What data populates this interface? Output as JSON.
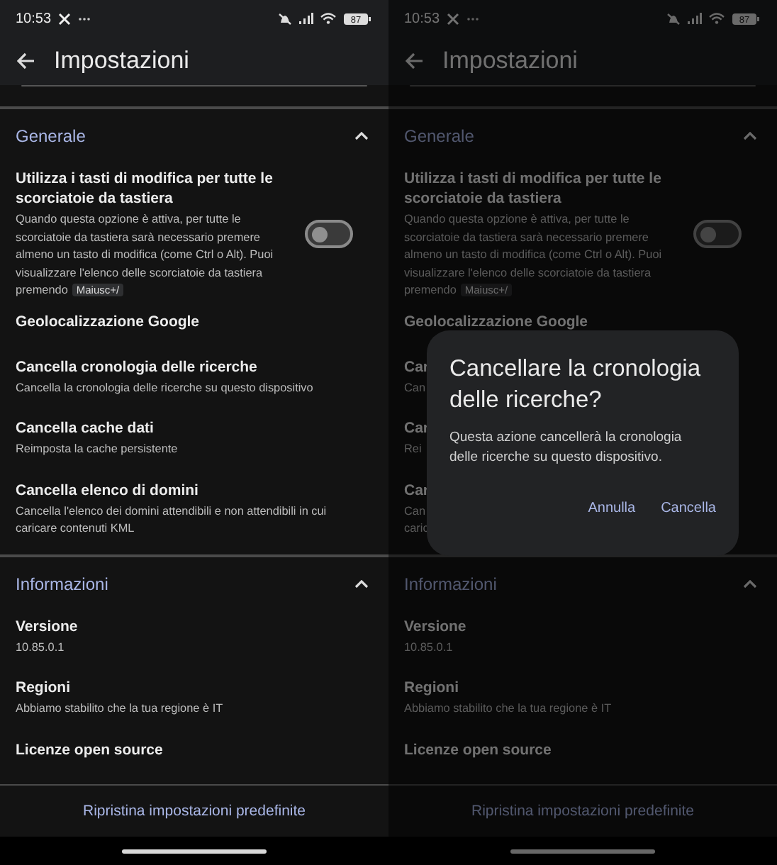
{
  "screens": [
    {
      "dimmed": false,
      "status": {
        "time": "10:53",
        "battery": "87"
      },
      "title": "Impostazioni",
      "sections": [
        {
          "title": "Generale",
          "expanded": true,
          "items": [
            {
              "kind": "toggle",
              "title": "Utilizza i tasti di modifica per tutte le scorciatoie da tastiera",
              "description": "Quando questa opzione è attiva, per tutte le scorciatoie da tastiera sarà necessario premere almeno un tasto di modifica (come Ctrl o Alt). Puoi visualizzare l'elenco delle scorciatoie da tastiera premendo",
              "shortcut": "Maiusc+/",
              "on": false
            },
            {
              "kind": "text",
              "title": "Geolocalizzazione Google"
            },
            {
              "kind": "text",
              "title": "Cancella cronologia delle ricerche",
              "description": "Cancella la cronologia delle ricerche su questo dispositivo"
            },
            {
              "kind": "text",
              "title": "Cancella cache dati",
              "description": "Reimposta la cache persistente"
            },
            {
              "kind": "text",
              "title": "Cancella elenco di domini",
              "description": "Cancella l'elenco dei domini attendibili e non attendibili in cui caricare contenuti KML"
            }
          ]
        },
        {
          "title": "Informazioni",
          "expanded": true,
          "items": [
            {
              "kind": "text",
              "title": "Versione",
              "description": "10.85.0.1"
            },
            {
              "kind": "text",
              "title": "Regioni",
              "description": "Abbiamo stabilito che la tua regione è IT"
            },
            {
              "kind": "text",
              "title": "Licenze open source"
            }
          ]
        }
      ],
      "footer": "Ripristina impostazioni predefinite"
    },
    {
      "dimmed": true,
      "status": {
        "time": "10:53",
        "battery": "87"
      },
      "title": "Impostazioni",
      "sections": [
        {
          "title": "Generale",
          "expanded": true,
          "items": [
            {
              "kind": "toggle",
              "title": "Utilizza i tasti di modifica per tutte le scorciatoie da tastiera",
              "description": "Quando questa opzione è attiva, per tutte le scorciatoie da tastiera sarà necessario premere almeno un tasto di modifica (come Ctrl o Alt). Puoi visualizzare l'elenco delle scorciatoie da tastiera premendo",
              "shortcut": "Maiusc+/",
              "on": false
            },
            {
              "kind": "text",
              "title": "Geolocalizzazione Google"
            },
            {
              "kind": "text",
              "title": "Car",
              "description": "Can"
            },
            {
              "kind": "text",
              "title": "Car",
              "description": "Rei"
            },
            {
              "kind": "text",
              "title": "Car",
              "description": "Can\ncaric"
            }
          ]
        },
        {
          "title": "Informazioni",
          "expanded": true,
          "items": [
            {
              "kind": "text",
              "title": "Versione",
              "description": "10.85.0.1"
            },
            {
              "kind": "text",
              "title": "Regioni",
              "description": "Abbiamo stabilito che la tua regione è IT"
            },
            {
              "kind": "text",
              "title": "Licenze open source"
            }
          ]
        }
      ],
      "footer": "Ripristina impostazioni predefinite",
      "dialog": {
        "title": "Cancellare la cronologia delle ricerche?",
        "body": "Questa azione cancellerà la cronologia delle ricerche su questo dispositivo.",
        "buttons": [
          "Annulla",
          "Cancella"
        ]
      }
    }
  ]
}
